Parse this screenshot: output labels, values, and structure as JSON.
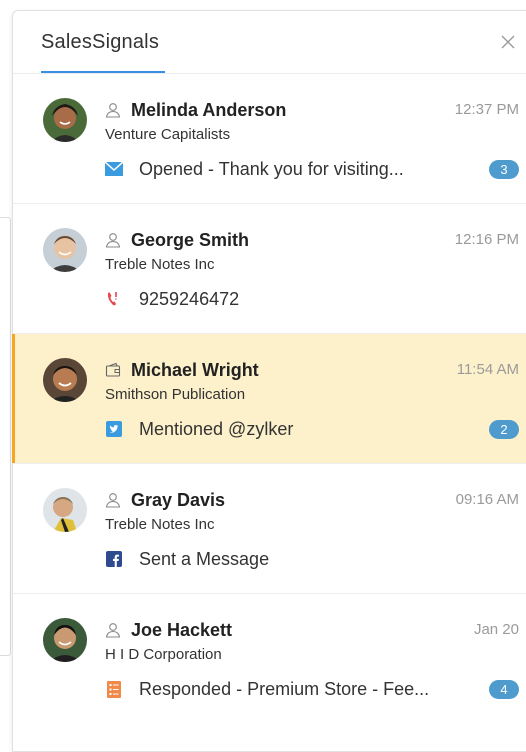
{
  "header": {
    "title": "SalesSignals"
  },
  "colors": {
    "accent": "#3a8ee6",
    "highlight_bg": "#fdf1cc",
    "highlight_bar": "#f5a623",
    "badge": "#4f9bcd"
  },
  "signals": [
    {
      "name": "Melinda Anderson",
      "company": "Venture Capitalists",
      "time": "12:37 PM",
      "contact_icon": "user-icon",
      "activity_icon": "email-icon",
      "activity": "Opened - Thank you for visiting...",
      "badge": "3"
    },
    {
      "name": "George Smith",
      "company": "Treble Notes Inc",
      "time": "12:16 PM",
      "contact_icon": "user-icon",
      "activity_icon": "missed-call-icon",
      "activity": "9259246472",
      "badge": ""
    },
    {
      "name": "Michael Wright",
      "company": "Smithson Publication",
      "time": "11:54 AM",
      "contact_icon": "wallet-icon",
      "activity_icon": "twitter-icon",
      "activity": "Mentioned @zylker",
      "badge": "2",
      "selected": true
    },
    {
      "name": "Gray Davis",
      "company": "Treble Notes Inc",
      "time": "09:16 AM",
      "contact_icon": "user-icon",
      "activity_icon": "facebook-icon",
      "activity": "Sent a Message",
      "badge": ""
    },
    {
      "name": "Joe Hackett",
      "company": "H I D Corporation",
      "time": "Jan 20",
      "contact_icon": "user-icon",
      "activity_icon": "survey-icon",
      "activity": "Responded - Premium Store - Fee...",
      "badge": "4"
    }
  ]
}
